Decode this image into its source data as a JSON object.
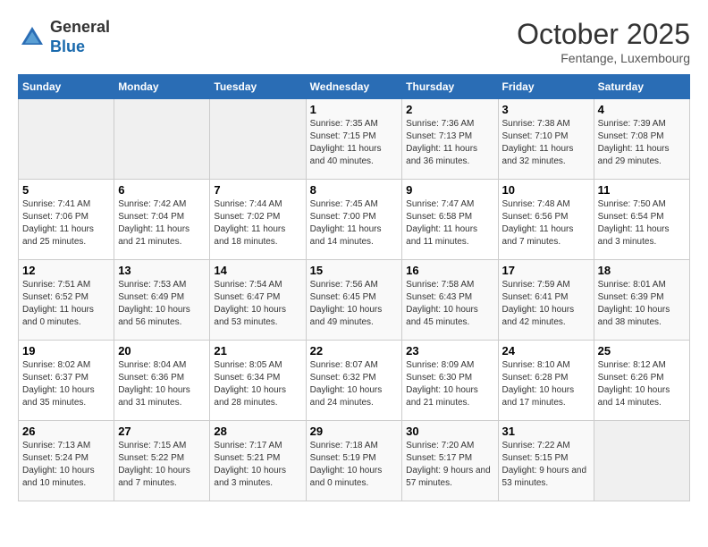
{
  "header": {
    "logo_line1": "General",
    "logo_line2": "Blue",
    "month": "October 2025",
    "location": "Fentange, Luxembourg"
  },
  "weekdays": [
    "Sunday",
    "Monday",
    "Tuesday",
    "Wednesday",
    "Thursday",
    "Friday",
    "Saturday"
  ],
  "weeks": [
    [
      {
        "day": "",
        "sunrise": "",
        "sunset": "",
        "daylight": ""
      },
      {
        "day": "",
        "sunrise": "",
        "sunset": "",
        "daylight": ""
      },
      {
        "day": "",
        "sunrise": "",
        "sunset": "",
        "daylight": ""
      },
      {
        "day": "1",
        "sunrise": "Sunrise: 7:35 AM",
        "sunset": "Sunset: 7:15 PM",
        "daylight": "Daylight: 11 hours and 40 minutes."
      },
      {
        "day": "2",
        "sunrise": "Sunrise: 7:36 AM",
        "sunset": "Sunset: 7:13 PM",
        "daylight": "Daylight: 11 hours and 36 minutes."
      },
      {
        "day": "3",
        "sunrise": "Sunrise: 7:38 AM",
        "sunset": "Sunset: 7:10 PM",
        "daylight": "Daylight: 11 hours and 32 minutes."
      },
      {
        "day": "4",
        "sunrise": "Sunrise: 7:39 AM",
        "sunset": "Sunset: 7:08 PM",
        "daylight": "Daylight: 11 hours and 29 minutes."
      }
    ],
    [
      {
        "day": "5",
        "sunrise": "Sunrise: 7:41 AM",
        "sunset": "Sunset: 7:06 PM",
        "daylight": "Daylight: 11 hours and 25 minutes."
      },
      {
        "day": "6",
        "sunrise": "Sunrise: 7:42 AM",
        "sunset": "Sunset: 7:04 PM",
        "daylight": "Daylight: 11 hours and 21 minutes."
      },
      {
        "day": "7",
        "sunrise": "Sunrise: 7:44 AM",
        "sunset": "Sunset: 7:02 PM",
        "daylight": "Daylight: 11 hours and 18 minutes."
      },
      {
        "day": "8",
        "sunrise": "Sunrise: 7:45 AM",
        "sunset": "Sunset: 7:00 PM",
        "daylight": "Daylight: 11 hours and 14 minutes."
      },
      {
        "day": "9",
        "sunrise": "Sunrise: 7:47 AM",
        "sunset": "Sunset: 6:58 PM",
        "daylight": "Daylight: 11 hours and 11 minutes."
      },
      {
        "day": "10",
        "sunrise": "Sunrise: 7:48 AM",
        "sunset": "Sunset: 6:56 PM",
        "daylight": "Daylight: 11 hours and 7 minutes."
      },
      {
        "day": "11",
        "sunrise": "Sunrise: 7:50 AM",
        "sunset": "Sunset: 6:54 PM",
        "daylight": "Daylight: 11 hours and 3 minutes."
      }
    ],
    [
      {
        "day": "12",
        "sunrise": "Sunrise: 7:51 AM",
        "sunset": "Sunset: 6:52 PM",
        "daylight": "Daylight: 11 hours and 0 minutes."
      },
      {
        "day": "13",
        "sunrise": "Sunrise: 7:53 AM",
        "sunset": "Sunset: 6:49 PM",
        "daylight": "Daylight: 10 hours and 56 minutes."
      },
      {
        "day": "14",
        "sunrise": "Sunrise: 7:54 AM",
        "sunset": "Sunset: 6:47 PM",
        "daylight": "Daylight: 10 hours and 53 minutes."
      },
      {
        "day": "15",
        "sunrise": "Sunrise: 7:56 AM",
        "sunset": "Sunset: 6:45 PM",
        "daylight": "Daylight: 10 hours and 49 minutes."
      },
      {
        "day": "16",
        "sunrise": "Sunrise: 7:58 AM",
        "sunset": "Sunset: 6:43 PM",
        "daylight": "Daylight: 10 hours and 45 minutes."
      },
      {
        "day": "17",
        "sunrise": "Sunrise: 7:59 AM",
        "sunset": "Sunset: 6:41 PM",
        "daylight": "Daylight: 10 hours and 42 minutes."
      },
      {
        "day": "18",
        "sunrise": "Sunrise: 8:01 AM",
        "sunset": "Sunset: 6:39 PM",
        "daylight": "Daylight: 10 hours and 38 minutes."
      }
    ],
    [
      {
        "day": "19",
        "sunrise": "Sunrise: 8:02 AM",
        "sunset": "Sunset: 6:37 PM",
        "daylight": "Daylight: 10 hours and 35 minutes."
      },
      {
        "day": "20",
        "sunrise": "Sunrise: 8:04 AM",
        "sunset": "Sunset: 6:36 PM",
        "daylight": "Daylight: 10 hours and 31 minutes."
      },
      {
        "day": "21",
        "sunrise": "Sunrise: 8:05 AM",
        "sunset": "Sunset: 6:34 PM",
        "daylight": "Daylight: 10 hours and 28 minutes."
      },
      {
        "day": "22",
        "sunrise": "Sunrise: 8:07 AM",
        "sunset": "Sunset: 6:32 PM",
        "daylight": "Daylight: 10 hours and 24 minutes."
      },
      {
        "day": "23",
        "sunrise": "Sunrise: 8:09 AM",
        "sunset": "Sunset: 6:30 PM",
        "daylight": "Daylight: 10 hours and 21 minutes."
      },
      {
        "day": "24",
        "sunrise": "Sunrise: 8:10 AM",
        "sunset": "Sunset: 6:28 PM",
        "daylight": "Daylight: 10 hours and 17 minutes."
      },
      {
        "day": "25",
        "sunrise": "Sunrise: 8:12 AM",
        "sunset": "Sunset: 6:26 PM",
        "daylight": "Daylight: 10 hours and 14 minutes."
      }
    ],
    [
      {
        "day": "26",
        "sunrise": "Sunrise: 7:13 AM",
        "sunset": "Sunset: 5:24 PM",
        "daylight": "Daylight: 10 hours and 10 minutes."
      },
      {
        "day": "27",
        "sunrise": "Sunrise: 7:15 AM",
        "sunset": "Sunset: 5:22 PM",
        "daylight": "Daylight: 10 hours and 7 minutes."
      },
      {
        "day": "28",
        "sunrise": "Sunrise: 7:17 AM",
        "sunset": "Sunset: 5:21 PM",
        "daylight": "Daylight: 10 hours and 3 minutes."
      },
      {
        "day": "29",
        "sunrise": "Sunrise: 7:18 AM",
        "sunset": "Sunset: 5:19 PM",
        "daylight": "Daylight: 10 hours and 0 minutes."
      },
      {
        "day": "30",
        "sunrise": "Sunrise: 7:20 AM",
        "sunset": "Sunset: 5:17 PM",
        "daylight": "Daylight: 9 hours and 57 minutes."
      },
      {
        "day": "31",
        "sunrise": "Sunrise: 7:22 AM",
        "sunset": "Sunset: 5:15 PM",
        "daylight": "Daylight: 9 hours and 53 minutes."
      },
      {
        "day": "",
        "sunrise": "",
        "sunset": "",
        "daylight": ""
      }
    ]
  ]
}
